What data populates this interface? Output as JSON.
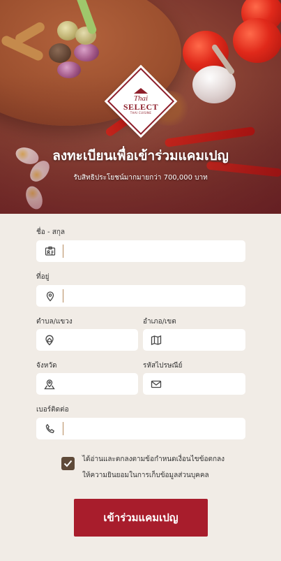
{
  "hero": {
    "title": "ลงทะเบียนเพื่อเข้าร่วมแคมเปญ",
    "subtitle": "รับสิทธิประโยชน์มากมายกว่า 700,000 บาท",
    "logo": {
      "line1": "Thai",
      "line2": "SELECT",
      "line3": "THAI CUISINE"
    }
  },
  "form": {
    "fullname": {
      "label": "ชื่อ - สกุล",
      "value": "",
      "placeholder": "",
      "icon": "id-card-icon"
    },
    "address": {
      "label": "ที่อยู่",
      "value": "",
      "placeholder": "",
      "icon": "location-pin-icon"
    },
    "subdistrict": {
      "label": "ตำบล/แขวง",
      "value": "",
      "placeholder": "",
      "icon": "home-pin-icon"
    },
    "district": {
      "label": "อำเภอ/เขต",
      "value": "",
      "placeholder": "",
      "icon": "map-icon"
    },
    "province": {
      "label": "จังหวัด",
      "value": "",
      "placeholder": "",
      "icon": "map-pin-icon"
    },
    "postcode": {
      "label": "รหัสไปรษณีย์",
      "value": "",
      "placeholder": "",
      "icon": "envelope-icon"
    },
    "phone": {
      "label": "เบอร์ติดต่อ",
      "value": "",
      "placeholder": "",
      "icon": "phone-icon"
    }
  },
  "consent": {
    "checked": true,
    "line1": "ได้อ่านและตกลงตามข้อกำหนดเงื่อนไขข้อตกลง",
    "line2": "ให้ความยินยอมในการเก็บข้อมูลส่วนบุคคล"
  },
  "submit_label": "เข้าร่วมแคมเปญ",
  "colors": {
    "brand": "#a81d2c",
    "checkbox": "#5f4a39",
    "background": "#f1ece6",
    "divider": "#b5895c"
  }
}
